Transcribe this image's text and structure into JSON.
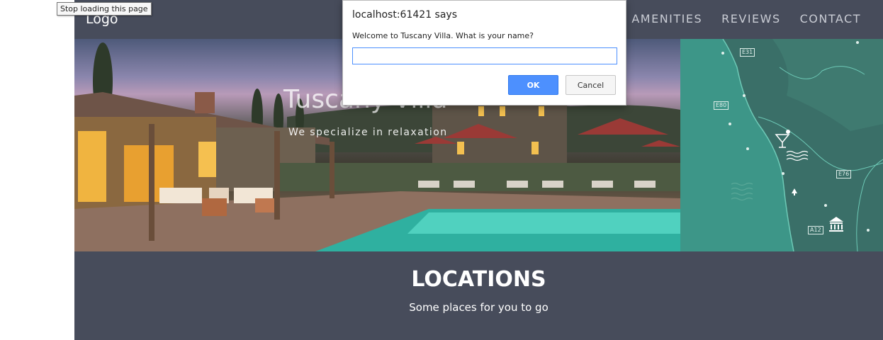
{
  "navbar": {
    "logo": "Logo",
    "links": [
      "AMENITIES",
      "REVIEWS",
      "CONTACT"
    ]
  },
  "hero": {
    "title": "Tuscany Villa",
    "subtitle": "We specialize in relaxation"
  },
  "map": {
    "roads": [
      "E31",
      "E80",
      "E76",
      "A12"
    ]
  },
  "locations": {
    "title": "LOCATIONS",
    "subtitle": "Some places for you to go"
  },
  "tooltip": {
    "text": "Stop loading this page"
  },
  "dialog": {
    "title": "localhost:61421 says",
    "message": "Welcome to Tuscany Villa. What is your name?",
    "input_value": "",
    "ok_label": "OK",
    "cancel_label": "Cancel"
  },
  "colors": {
    "navbar_bg": "#474c5b",
    "map_bg": "#3a6f68",
    "accent_blue": "#4d90fe"
  }
}
